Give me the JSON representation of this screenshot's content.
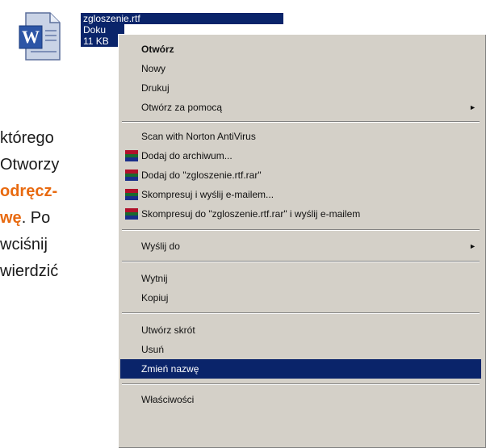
{
  "file": {
    "name": "zgloszenie.rtf",
    "type_line": "Doku",
    "size_line": "11 KB",
    "icon": "word-document-icon"
  },
  "background_text": [
    "którego",
    "Otworzy",
    "odręcz-",
    "wę. Po",
    "wciśnij",
    "wierdzić"
  ],
  "background_text_emphasis": [
    "odręcz-",
    "wę"
  ],
  "colors": {
    "menu_bg": "#d4d0c8",
    "selection": "#0a246a",
    "accent_text": "#e86a10"
  },
  "menu": {
    "open": "Otwórz",
    "new": "Nowy",
    "print": "Drukuj",
    "open_with": "Otwórz za pomocą",
    "scan": "Scan with Norton AntiVirus",
    "add_archive": "Dodaj do archiwum...",
    "add_to_rar": "Dodaj do \"zgloszenie.rtf.rar\"",
    "compress_email": "Skompresuj i wyślij e-mailem...",
    "compress_rar_email": "Skompresuj do \"zgloszenie.rtf.rar\" i wyślij e-mailem",
    "send_to": "Wyślij do",
    "cut": "Wytnij",
    "copy": "Kopiuj",
    "create_shortcut": "Utwórz skrót",
    "delete": "Usuń",
    "rename": "Zmień nazwę",
    "properties": "Właściwości",
    "submenu_arrow": "►"
  }
}
